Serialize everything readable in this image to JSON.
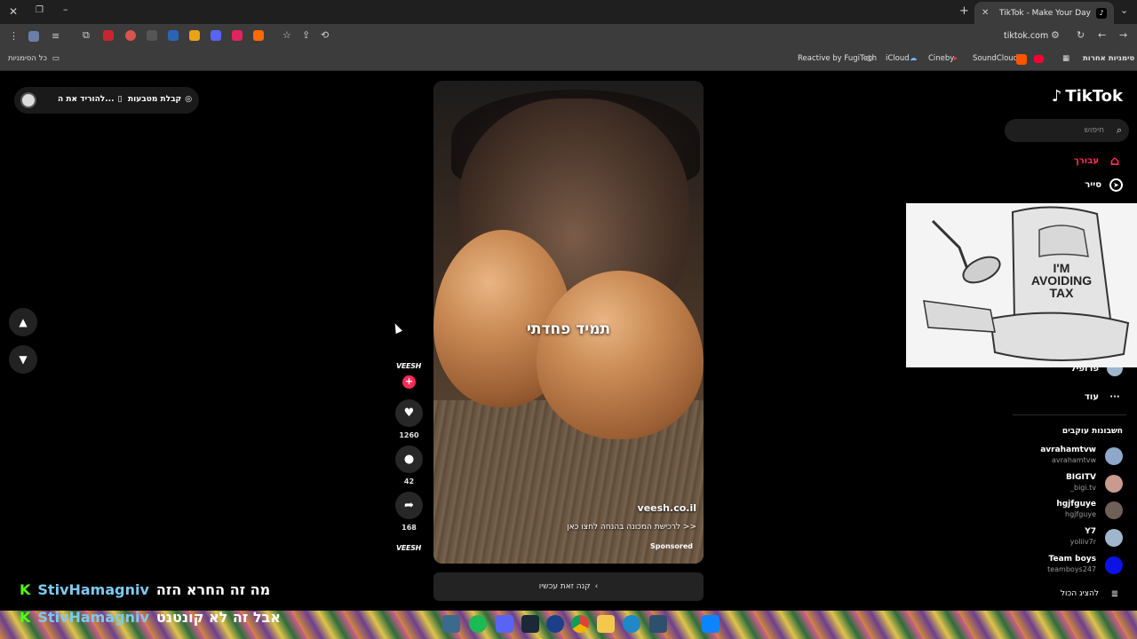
{
  "browser": {
    "active_tab_title": "TikTok - Make Your Day",
    "url": "tiktok.com",
    "bookmarks_right_label": "סימניות אחרות",
    "bookmarks_left_label": "כל הסימניות",
    "bookmarks": [
      "Reactive by FugiTech",
      "iCloud",
      "Cineby",
      "SoundCloud"
    ]
  },
  "tiktok": {
    "logo_text": "TikTok",
    "search_placeholder": "חיפוש",
    "nav": [
      {
        "label": "עבורך",
        "icon": "home-icon",
        "active": true
      },
      {
        "label": "סייר",
        "icon": "explore-icon",
        "active": false
      }
    ],
    "profile_label": "פרופיל",
    "more_label": "עוד",
    "following_title": "חשבונות עוקבים",
    "accounts": [
      {
        "name": "avrahamtvw",
        "handle": "avrahamtvw",
        "color": "#8fa7c8"
      },
      {
        "name": "BIGITV",
        "handle": "_bigi.tv",
        "color": "#c99b8e"
      },
      {
        "name": "hgjfguye",
        "handle": "hgjfguye",
        "color": "#6e5f58"
      },
      {
        "name": "Y7",
        "handle": "yoliiv7r",
        "color": "#9fb6cc"
      },
      {
        "name": "Team boys",
        "handle": "teamboys247",
        "color": "#0a12e8"
      }
    ],
    "show_all_label": "להציג הכול",
    "top_pill": {
      "coins_label": "קבלת מטבעות",
      "download_label": "להוריד את ה..."
    },
    "video": {
      "caption": "תמיד פחדתי",
      "ad_domain": "veesh.co.il",
      "ad_text": "לרכישת המכונה בהנחה לחצו כאן >>",
      "sponsored": "Sponsored",
      "buy_button": "קנה זאת עכשיו",
      "brand": "VEESH"
    },
    "actions": {
      "likes": "1260",
      "comments": "42",
      "shares": "168"
    }
  },
  "overlay_image_text": "I'M AVOIDING TAX",
  "chat": [
    {
      "user": "StivHamagniv",
      "message": "מה זה החרא הזה"
    },
    {
      "user": "StivHamagniv",
      "message": "אבל זה לא קונטנט"
    }
  ],
  "colors": {
    "tiktok_red": "#fe2c55",
    "kick_green": "#53fc18"
  }
}
